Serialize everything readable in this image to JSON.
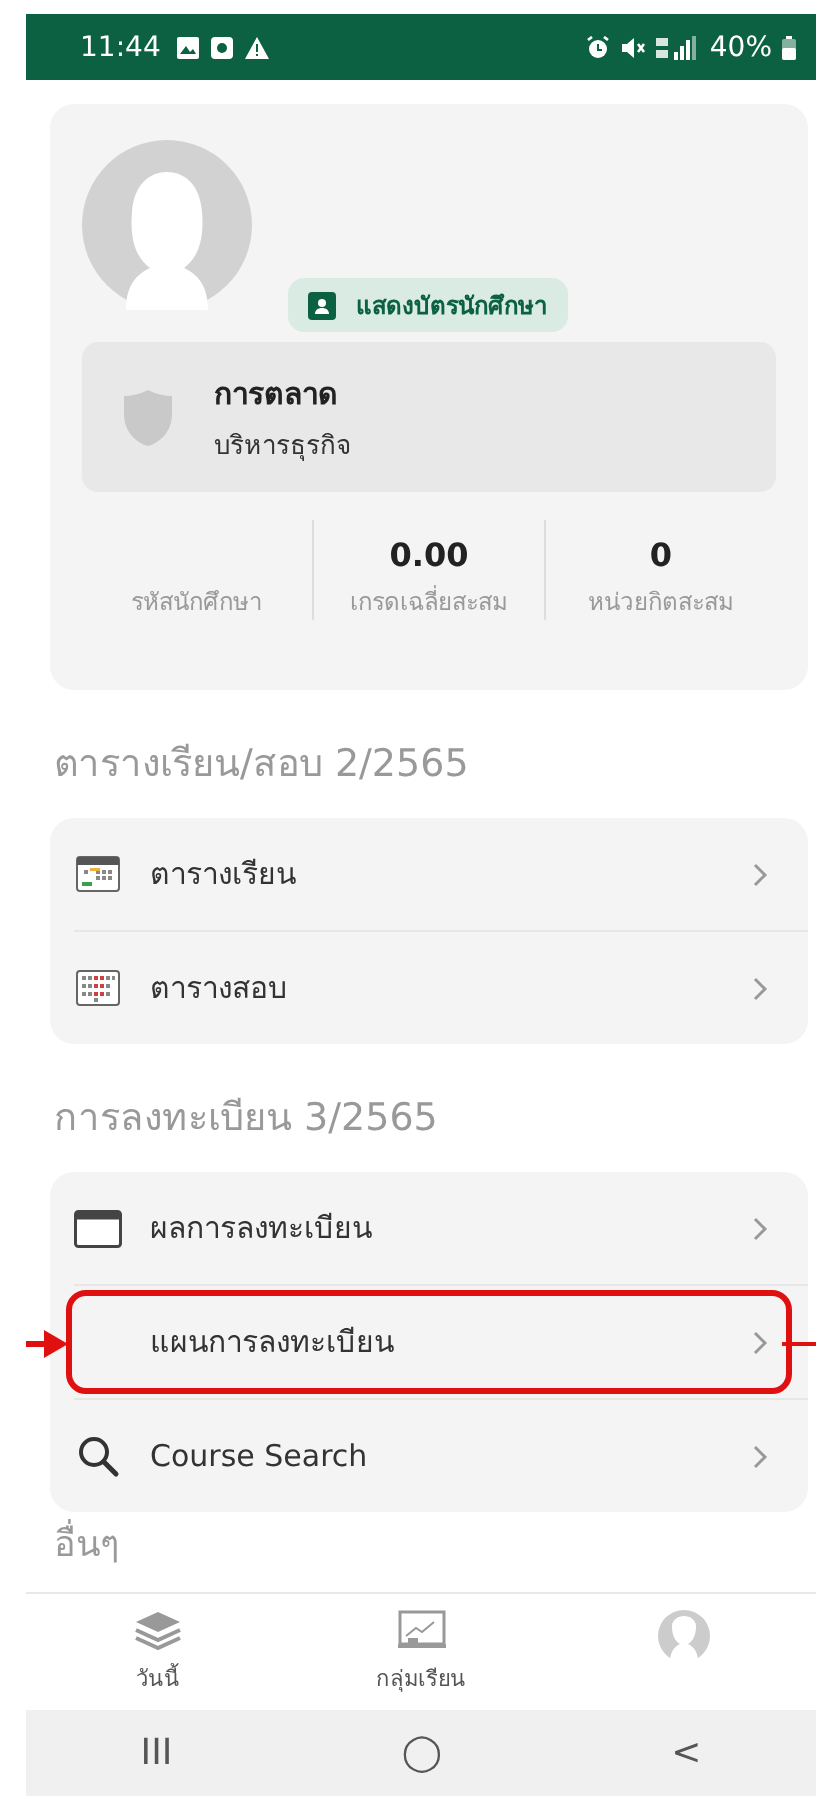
{
  "status_bar": {
    "time": "11:44",
    "battery": "40%"
  },
  "profile": {
    "id_card_button": "แสดงบัตรนักศึกษา",
    "major": "การตลาด",
    "faculty": "บริหารธุรกิจ",
    "stats": [
      {
        "label": "รหัสนักศึกษา"
      },
      {
        "value": "0.00",
        "label": "เกรดเฉลี่ยสะสม"
      },
      {
        "value": "0",
        "label": "หน่วยกิตสะสม"
      }
    ]
  },
  "sections": [
    {
      "title": "ตารางเรียน/สอบ 2/2565",
      "items": [
        {
          "label": "ตารางเรียน",
          "highlighted": false
        },
        {
          "label": "ตารางสอบ",
          "highlighted": false
        }
      ]
    },
    {
      "title": "การลงทะเบียน 3/2565",
      "items": [
        {
          "label": "ผลการลงทะเบียน",
          "highlighted": false
        },
        {
          "label": "แผนการลงทะเบียน",
          "highlighted": true
        },
        {
          "label": "Course Search",
          "highlighted": false
        }
      ]
    },
    {
      "title": "อื่นๆ"
    }
  ],
  "bottom_nav": [
    "วันนี้",
    "กลุ่มเรียน"
  ],
  "system_nav": [
    "III",
    "◯",
    "<"
  ]
}
